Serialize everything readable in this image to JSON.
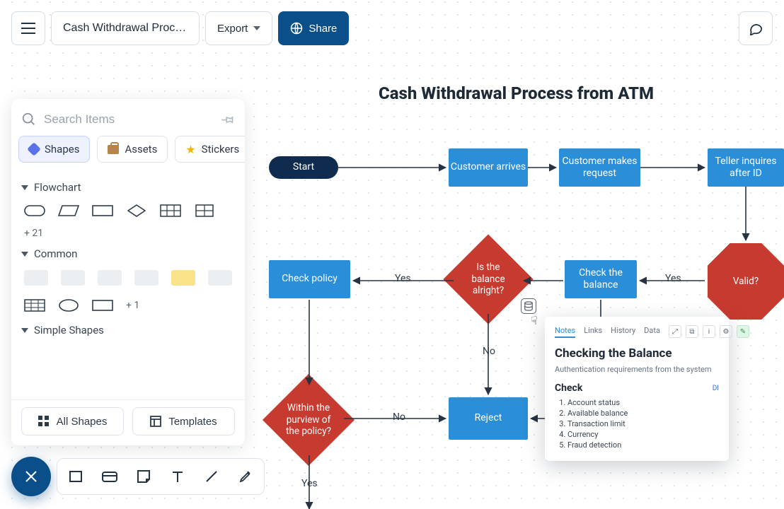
{
  "topbar": {
    "title": "Cash Withdrawal Proces…",
    "export": "Export",
    "share": "Share"
  },
  "search": {
    "placeholder": "Search Items"
  },
  "tabs": {
    "shapes": "Shapes",
    "assets": "Assets",
    "stickers": "Stickers"
  },
  "categories": {
    "flowchart": {
      "label": "Flowchart",
      "more": "+ 21"
    },
    "common": {
      "label": "Common",
      "more": "+ 1"
    },
    "simple": {
      "label": "Simple Shapes"
    }
  },
  "footer": {
    "allShapes": "All Shapes",
    "templates": "Templates"
  },
  "diagram": {
    "title": "Cash Withdrawal Process from ATM",
    "start": "Start",
    "n1": "Customer arrives",
    "n2": "Customer makes request",
    "n3": "Teller inquires after ID",
    "d_valid": "Valid?",
    "n4": "Check the balance",
    "d_balance": "Is the balance alright?",
    "n5": "Check policy",
    "d_policy": "Within the purview of the policy?",
    "n6": "Reject",
    "labels": {
      "yes": "Yes",
      "no": "No"
    }
  },
  "popover": {
    "tabs": {
      "notes": "Notes",
      "links": "Links",
      "history": "History",
      "data": "Data"
    },
    "title": "Checking the Balance",
    "subtitle": "Authentication requirements from the system",
    "section": "Check",
    "marker": "DI",
    "items": [
      "Account status",
      "Available balance",
      "Transaction limit",
      "Currency",
      "Fraud detection"
    ]
  }
}
